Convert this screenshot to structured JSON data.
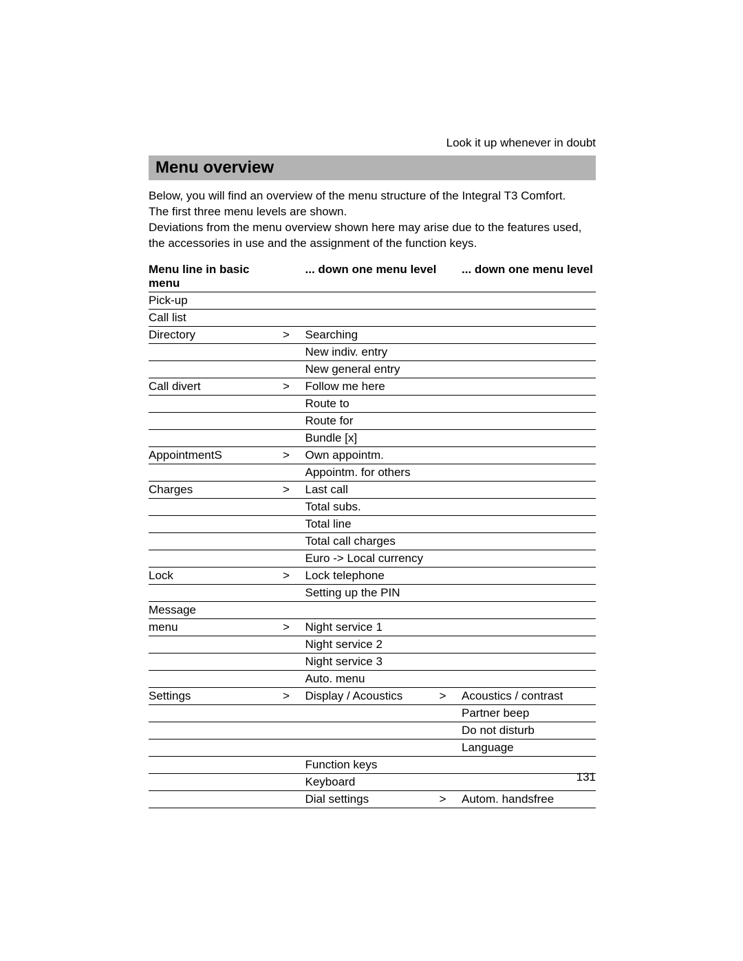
{
  "header_right": "Look it up whenever in doubt",
  "title": "Menu overview",
  "intro_p1_l1": "Below, you will find an overview of the menu structure of the Integral T3 Comfort.",
  "intro_p1_l2": "The first three menu levels are shown.",
  "intro_p2_l1": "Deviations from the menu overview shown here may arise due to the features used,",
  "intro_p2_l2": "the accessories in use and the assignment of the function keys.",
  "th1": "Menu line in basic menu",
  "th2": "... down one menu level",
  "th3": "... down one menu level",
  "gt": ">",
  "rows": {
    "r1c1": "Pick-up",
    "r2c1": "Call list",
    "r3c1": "Directory",
    "r3c2": "Searching",
    "r4c2": "New indiv. entry",
    "r5c2": "New general entry",
    "r6c1": "Call divert",
    "r6c2": "Follow me here",
    "r7c2": "Route to",
    "r8c2": "Route for",
    "r9c2": "Bundle [x]",
    "r10c1": "AppointmentS",
    "r10c2": "Own appointm.",
    "r11c2": "Appointm. for others",
    "r12c1": "Charges",
    "r12c2": "Last call",
    "r13c2": "Total subs.",
    "r14c2": "Total line",
    "r15c2": "Total call charges",
    "r16c2": "Euro -> Local currency",
    "r17c1": "Lock",
    "r17c2": "Lock telephone",
    "r18c2": "Setting up the PIN",
    "r19c1": "Message",
    "r20c1": "menu",
    "r20c2": "Night service 1",
    "r21c2": "Night service 2",
    "r22c2": "Night service 3",
    "r23c2": "Auto. menu",
    "r24c1": "Settings",
    "r24c2": "Display / Acoustics",
    "r24c3": "Acoustics / contrast",
    "r25c3": "Partner beep",
    "r26c3": "Do not disturb",
    "r27c3": "Language",
    "r28c2": "Function keys",
    "r29c2": "Keyboard",
    "r30c2": "Dial settings",
    "r30c3": "Autom. handsfree"
  },
  "page_number": "131"
}
